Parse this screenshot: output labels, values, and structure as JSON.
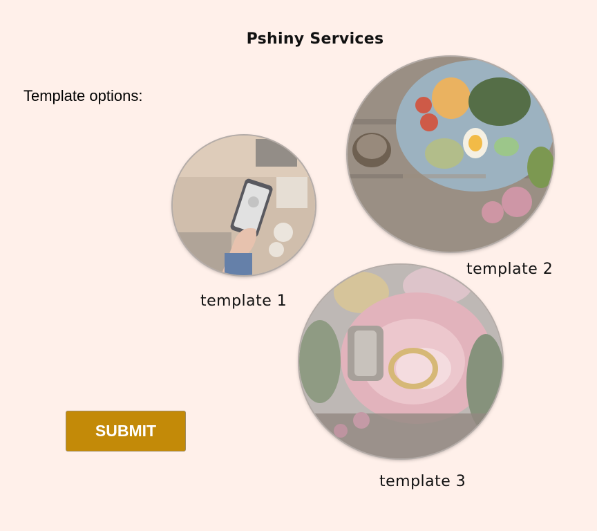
{
  "page": {
    "title": "Pshiny Services",
    "options_label": "Template options:"
  },
  "templates": [
    {
      "caption": "template 1",
      "image": "phone-on-wooden-desk"
    },
    {
      "caption": "template 2",
      "image": "salad-plate-food"
    },
    {
      "caption": "template 3",
      "image": "rings-on-rose"
    }
  ],
  "submit": {
    "label": "SUBMIT"
  },
  "colors": {
    "background": "#fff0ea",
    "accent": "#c38a08"
  }
}
